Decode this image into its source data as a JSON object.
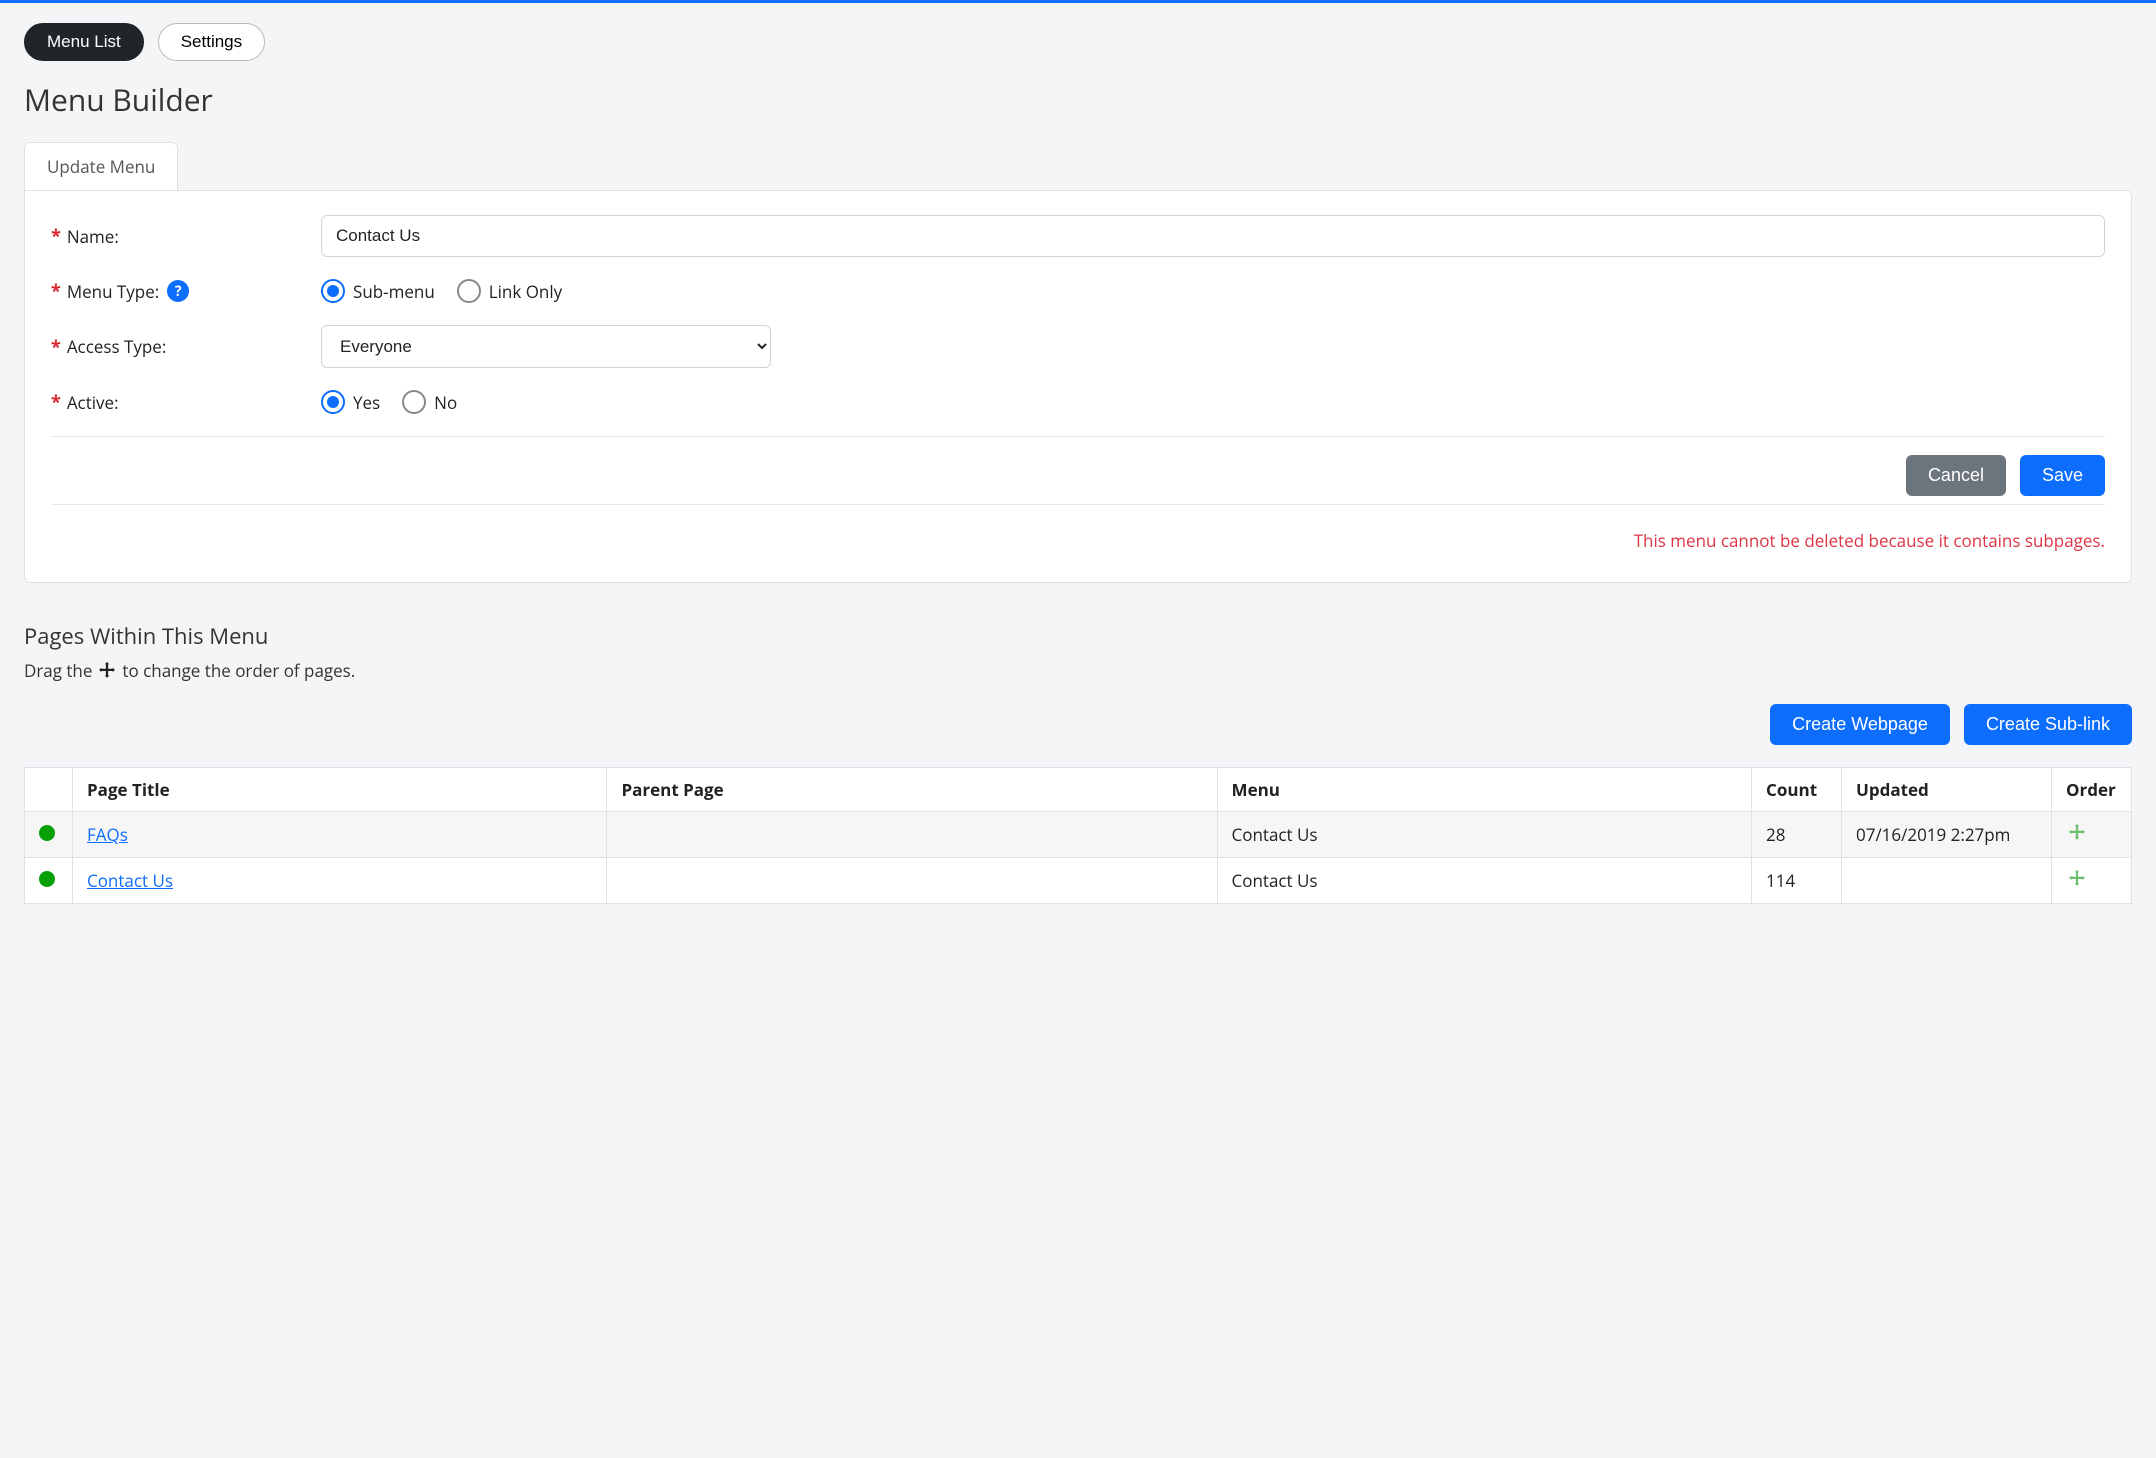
{
  "pills": {
    "menu_list": "Menu List",
    "settings": "Settings"
  },
  "title": "Menu Builder",
  "tab_label": "Update Menu",
  "form": {
    "name_label": "Name:",
    "name_value": "Contact Us",
    "menu_type_label": "Menu Type:",
    "menu_type_options": {
      "submenu": "Sub-menu",
      "link_only": "Link Only"
    },
    "access_type_label": "Access Type:",
    "access_type_value": "Everyone",
    "active_label": "Active:",
    "active_options": {
      "yes": "Yes",
      "no": "No"
    },
    "cancel": "Cancel",
    "save": "Save",
    "warning": "This menu cannot be deleted because it contains subpages."
  },
  "pages_section": {
    "title": "Pages Within This Menu",
    "hint_before": "Drag the",
    "hint_after": "to change the order of pages.",
    "create_webpage": "Create Webpage",
    "create_sublink": "Create Sub-link"
  },
  "table": {
    "headers": {
      "page_title": "Page Title",
      "parent_page": "Parent Page",
      "menu": "Menu",
      "count": "Count",
      "updated": "Updated",
      "order": "Order"
    },
    "rows": [
      {
        "title": "FAQs",
        "parent": "",
        "menu": "Contact Us",
        "count": "28",
        "updated": "07/16/2019 2:27pm"
      },
      {
        "title": "Contact Us",
        "parent": "",
        "menu": "Contact Us",
        "count": "114",
        "updated": ""
      }
    ]
  }
}
